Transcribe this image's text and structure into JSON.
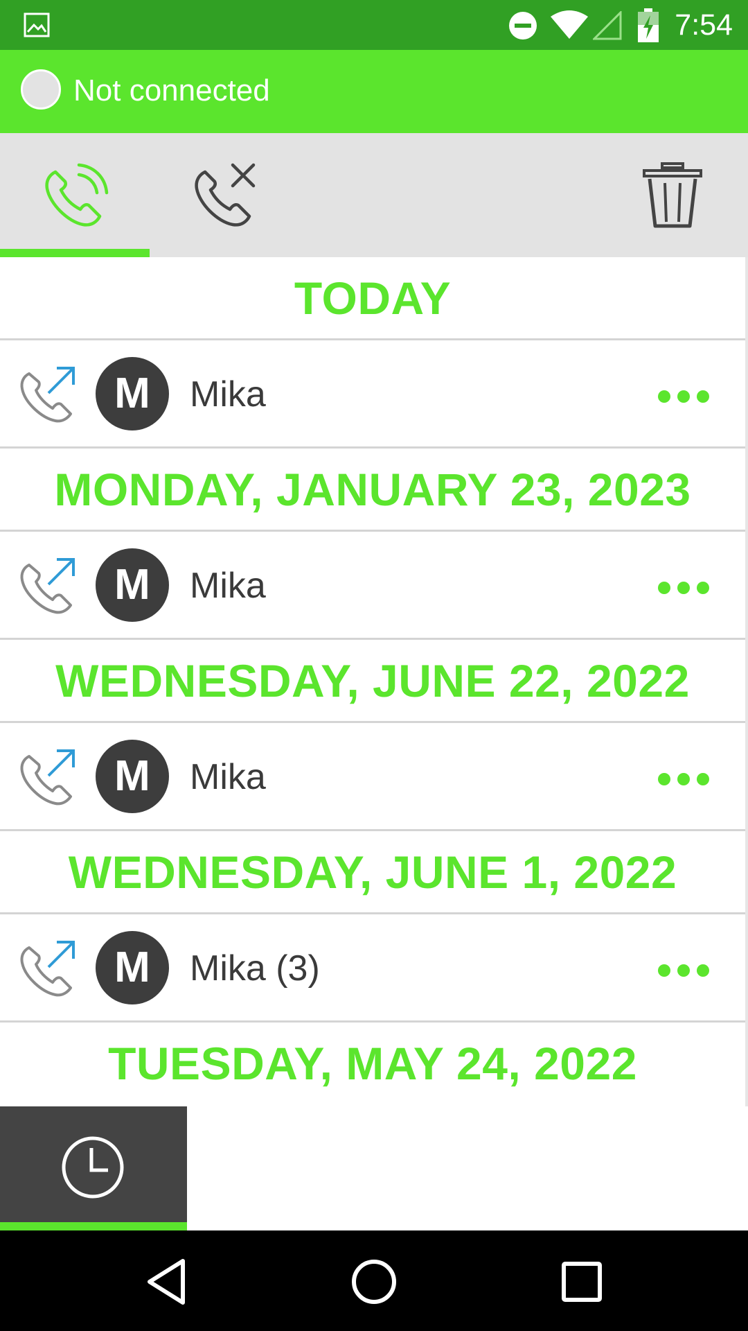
{
  "status_bar": {
    "time": "7:54",
    "icons": [
      "image-notification-icon",
      "do-not-disturb-icon",
      "wifi-icon",
      "cell-signal-icon",
      "battery-charging-icon"
    ]
  },
  "connection": {
    "status_text": "Not connected"
  },
  "toolbar": {
    "tabs": [
      {
        "icon": "call-history-icon",
        "active": true
      },
      {
        "icon": "missed-calls-icon",
        "active": false
      }
    ],
    "delete_icon": "trash-icon"
  },
  "colors": {
    "accent": "#5be52d",
    "status_bar": "#31a024",
    "toolbar_bg": "#e3e3e3",
    "avatar_bg": "#3d3d3d",
    "outgoing_arrow": "#2f9bd6"
  },
  "call_groups": [
    {
      "date": "TODAY",
      "calls": [
        {
          "initial": "M",
          "name": "Mika",
          "direction": "outgoing"
        }
      ]
    },
    {
      "date": "MONDAY, JANUARY 23, 2023",
      "calls": [
        {
          "initial": "M",
          "name": "Mika",
          "direction": "outgoing"
        }
      ]
    },
    {
      "date": "WEDNESDAY, JUNE 22, 2022",
      "calls": [
        {
          "initial": "M",
          "name": "Mika",
          "direction": "outgoing"
        }
      ]
    },
    {
      "date": "WEDNESDAY, JUNE 1, 2022",
      "calls": [
        {
          "initial": "M",
          "name": "Mika (3)",
          "direction": "outgoing"
        }
      ]
    },
    {
      "date": "TUESDAY, MAY 24, 2022",
      "calls": []
    }
  ],
  "bottom_tabs": [
    {
      "icon": "clock-icon",
      "active": true
    }
  ],
  "nav_bar": [
    "back-icon",
    "home-icon",
    "recents-icon"
  ]
}
